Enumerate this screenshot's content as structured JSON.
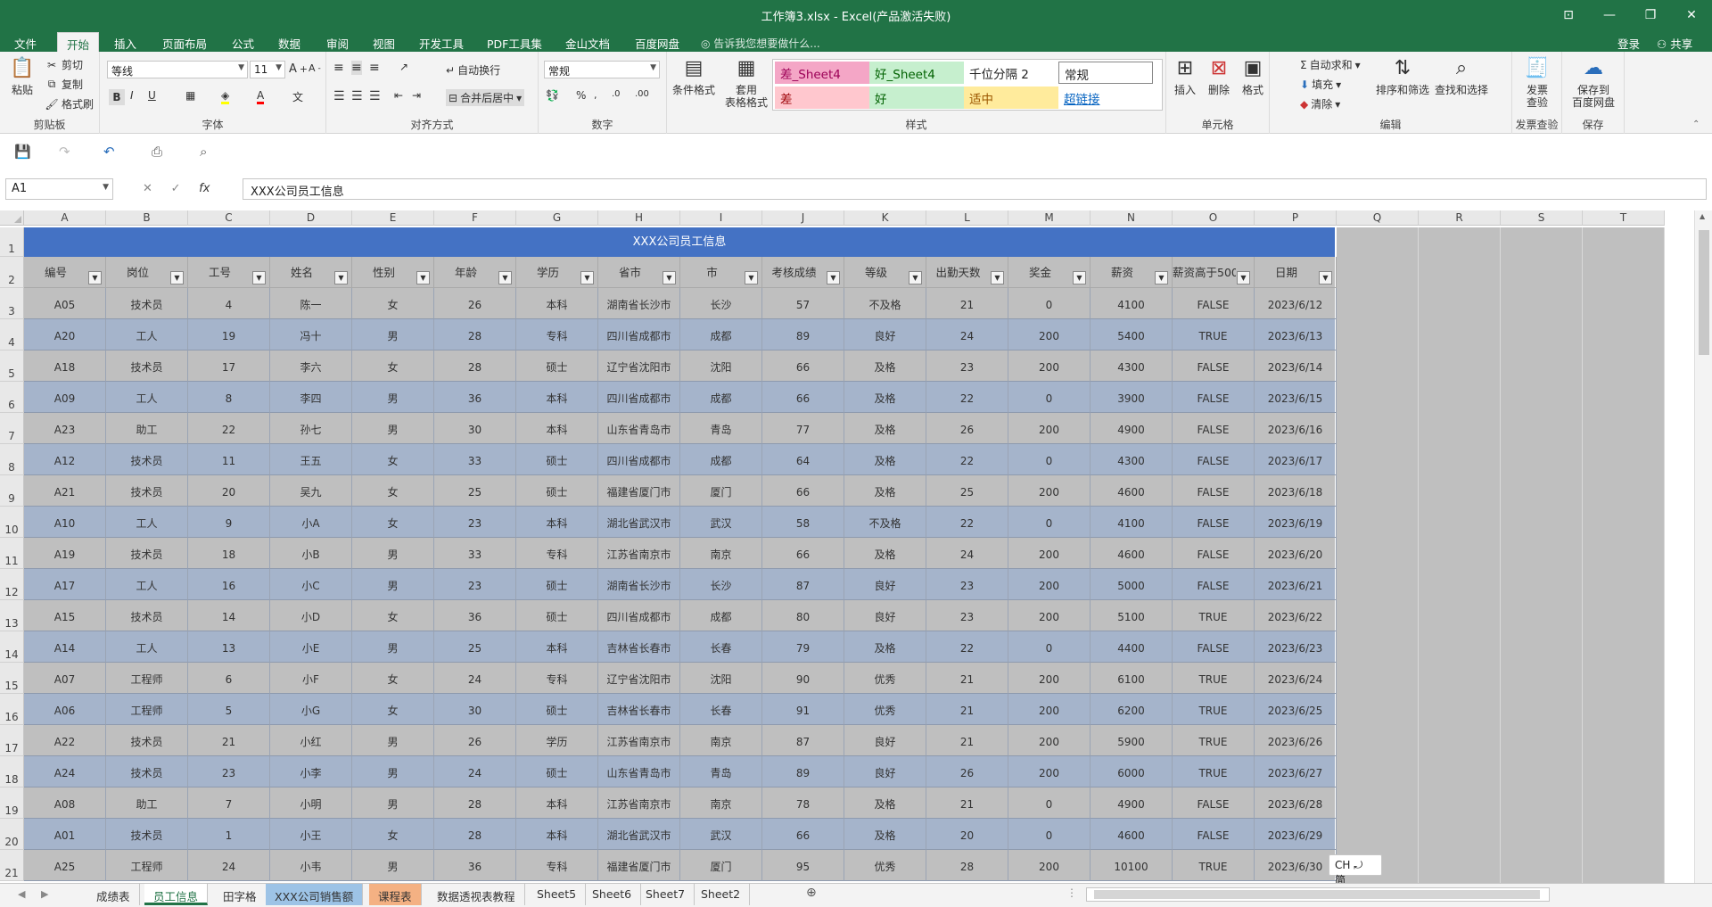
{
  "window": {
    "title": "工作簿3.xlsx - Excel(产品激活失败)",
    "controls": [
      "⊡",
      "—",
      "❐",
      "✕"
    ]
  },
  "tabs": [
    "文件",
    "开始",
    "插入",
    "页面布局",
    "公式",
    "数据",
    "审阅",
    "视图",
    "开发工具",
    "PDF工具集",
    "金山文档",
    "百度网盘"
  ],
  "active_tab": "开始",
  "tell_me": "告诉我您想要做什么...",
  "login": "登录",
  "share": "共享",
  "ribbon": {
    "clipboard": {
      "label": "剪贴板",
      "paste": "粘贴",
      "cut": "剪切",
      "copy": "复制",
      "format_painter": "格式刷"
    },
    "font": {
      "label": "字体",
      "font_name": "等线",
      "font_size": "11",
      "bold": "B",
      "italic": "I",
      "underline": "U"
    },
    "alignment": {
      "label": "对齐方式",
      "wrap": "自动换行",
      "merge": "合并后居中"
    },
    "number": {
      "label": "数字",
      "format": "常规"
    },
    "styles": {
      "label": "样式",
      "conditional": "条件格式",
      "table_format_1": "套用",
      "table_format_2": "表格格式",
      "cells": [
        {
          "text": "差_Sheet4",
          "bg": "#f4a6c6",
          "fg": "#9c0057"
        },
        {
          "text": "好_Sheet4",
          "bg": "#c6efce",
          "fg": "#006100"
        },
        {
          "text": "千位分隔 2",
          "bg": "#ffffff",
          "fg": "#222222"
        },
        {
          "text": "常规",
          "bg": "#ffffff",
          "fg": "#222222"
        },
        {
          "text": "差",
          "bg": "#ffc7ce",
          "fg": "#9c0006"
        },
        {
          "text": "好",
          "bg": "#c6efce",
          "fg": "#006100"
        },
        {
          "text": "适中",
          "bg": "#ffeb9c",
          "fg": "#9c5700"
        },
        {
          "text": "超链接",
          "bg": "#ffffff",
          "fg": "#0563c1"
        }
      ]
    },
    "cells_group": {
      "label": "单元格",
      "insert": "插入",
      "delete": "删除",
      "format": "格式"
    },
    "editing": {
      "label": "编辑",
      "autosum": "自动求和",
      "fill": "填充",
      "clear": "清除",
      "sort": "排序和筛选",
      "find": "查找和选择"
    },
    "invoice": {
      "label": "发票查验",
      "btn1": "发票",
      "btn2": "查验"
    },
    "save": {
      "label": "保存",
      "btn1": "保存到",
      "btn2": "百度网盘"
    }
  },
  "namebox": "A1",
  "formula": "XXX公司员工信息",
  "columns": [
    "A",
    "B",
    "C",
    "D",
    "E",
    "F",
    "G",
    "H",
    "I",
    "J",
    "K",
    "L",
    "M",
    "N",
    "O",
    "P",
    "Q",
    "R",
    "S",
    "T"
  ],
  "rows": [
    "1",
    "2",
    "3",
    "4",
    "5",
    "6",
    "7",
    "8",
    "9",
    "10",
    "11",
    "12",
    "13",
    "14",
    "15",
    "16",
    "17",
    "18",
    "19",
    "20",
    "21"
  ],
  "sheet_title": "XXX公司员工信息",
  "headers": [
    "编号",
    "岗位",
    "工号",
    "姓名",
    "性别",
    "年龄",
    "学历",
    "省市",
    "市",
    "考核成绩",
    "等级",
    "出勤天数",
    "奖金",
    "薪资",
    "薪资高于5000",
    "日期"
  ],
  "data": [
    [
      "A05",
      "技术员",
      "4",
      "陈一",
      "女",
      "26",
      "本科",
      "湖南省长沙市",
      "长沙",
      "57",
      "不及格",
      "21",
      "0",
      "4100",
      "FALSE",
      "2023/6/12"
    ],
    [
      "A20",
      "工人",
      "19",
      "冯十",
      "男",
      "28",
      "专科",
      "四川省成都市",
      "成都",
      "89",
      "良好",
      "24",
      "200",
      "5400",
      "TRUE",
      "2023/6/13"
    ],
    [
      "A18",
      "技术员",
      "17",
      "李六",
      "女",
      "28",
      "硕士",
      "辽宁省沈阳市",
      "沈阳",
      "66",
      "及格",
      "23",
      "200",
      "4300",
      "FALSE",
      "2023/6/14"
    ],
    [
      "A09",
      "工人",
      "8",
      "李四",
      "男",
      "36",
      "本科",
      "四川省成都市",
      "成都",
      "66",
      "及格",
      "22",
      "0",
      "3900",
      "FALSE",
      "2023/6/15"
    ],
    [
      "A23",
      "助工",
      "22",
      "孙七",
      "男",
      "30",
      "本科",
      "山东省青岛市",
      "青岛",
      "77",
      "及格",
      "26",
      "200",
      "4900",
      "FALSE",
      "2023/6/16"
    ],
    [
      "A12",
      "技术员",
      "11",
      "王五",
      "女",
      "33",
      "硕士",
      "四川省成都市",
      "成都",
      "64",
      "及格",
      "22",
      "0",
      "4300",
      "FALSE",
      "2023/6/17"
    ],
    [
      "A21",
      "技术员",
      "20",
      "吴九",
      "女",
      "25",
      "硕士",
      "福建省厦门市",
      "厦门",
      "66",
      "及格",
      "25",
      "200",
      "4600",
      "FALSE",
      "2023/6/18"
    ],
    [
      "A10",
      "工人",
      "9",
      "小A",
      "女",
      "23",
      "本科",
      "湖北省武汉市",
      "武汉",
      "58",
      "不及格",
      "22",
      "0",
      "4100",
      "FALSE",
      "2023/6/19"
    ],
    [
      "A19",
      "技术员",
      "18",
      "小B",
      "男",
      "33",
      "专科",
      "江苏省南京市",
      "南京",
      "66",
      "及格",
      "24",
      "200",
      "4600",
      "FALSE",
      "2023/6/20"
    ],
    [
      "A17",
      "工人",
      "16",
      "小C",
      "男",
      "23",
      "硕士",
      "湖南省长沙市",
      "长沙",
      "87",
      "良好",
      "23",
      "200",
      "5000",
      "FALSE",
      "2023/6/21"
    ],
    [
      "A15",
      "技术员",
      "14",
      "小D",
      "女",
      "36",
      "硕士",
      "四川省成都市",
      "成都",
      "80",
      "良好",
      "23",
      "200",
      "5100",
      "TRUE",
      "2023/6/22"
    ],
    [
      "A14",
      "工人",
      "13",
      "小E",
      "男",
      "25",
      "本科",
      "吉林省长春市",
      "长春",
      "79",
      "及格",
      "22",
      "0",
      "4400",
      "FALSE",
      "2023/6/23"
    ],
    [
      "A07",
      "工程师",
      "6",
      "小F",
      "女",
      "24",
      "专科",
      "辽宁省沈阳市",
      "沈阳",
      "90",
      "优秀",
      "21",
      "200",
      "6100",
      "TRUE",
      "2023/6/24"
    ],
    [
      "A06",
      "工程师",
      "5",
      "小G",
      "女",
      "30",
      "硕士",
      "吉林省长春市",
      "长春",
      "91",
      "优秀",
      "21",
      "200",
      "6200",
      "TRUE",
      "2023/6/25"
    ],
    [
      "A22",
      "技术员",
      "21",
      "小红",
      "男",
      "26",
      "学历",
      "江苏省南京市",
      "南京",
      "87",
      "良好",
      "21",
      "200",
      "5900",
      "TRUE",
      "2023/6/26"
    ],
    [
      "A24",
      "技术员",
      "23",
      "小李",
      "男",
      "24",
      "硕士",
      "山东省青岛市",
      "青岛",
      "89",
      "良好",
      "26",
      "200",
      "6000",
      "TRUE",
      "2023/6/27"
    ],
    [
      "A08",
      "助工",
      "7",
      "小明",
      "男",
      "28",
      "本科",
      "江苏省南京市",
      "南京",
      "78",
      "及格",
      "21",
      "0",
      "4900",
      "FALSE",
      "2023/6/28"
    ],
    [
      "A01",
      "技术员",
      "1",
      "小王",
      "女",
      "28",
      "本科",
      "湖北省武汉市",
      "武汉",
      "66",
      "及格",
      "20",
      "0",
      "4600",
      "FALSE",
      "2023/6/29"
    ],
    [
      "A25",
      "工程师",
      "24",
      "小韦",
      "男",
      "36",
      "专科",
      "福建省厦门市",
      "厦门",
      "95",
      "优秀",
      "28",
      "200",
      "10100",
      "TRUE",
      "2023/6/30"
    ]
  ],
  "ime": "CH ⤾ 简",
  "sheets": [
    {
      "name": "成绩表",
      "color": ""
    },
    {
      "name": "员工信息",
      "color": ""
    },
    {
      "name": "田字格",
      "color": ""
    },
    {
      "name": "XXX公司销售额",
      "color": "#9dc3e6"
    },
    {
      "name": "课程表",
      "color": "#f4b183"
    },
    {
      "name": "数据透视表教程",
      "color": ""
    },
    {
      "name": "Sheet5",
      "color": ""
    },
    {
      "name": "Sheet6",
      "color": ""
    },
    {
      "name": "Sheet7",
      "color": ""
    },
    {
      "name": "Sheet2",
      "color": ""
    }
  ],
  "active_sheet": "员工信息",
  "colors": {
    "accent": "#217346",
    "title_fill": "#4472c4",
    "row_gray": "#bfbfbf",
    "row_blue": "#a5b4cb",
    "annotation_arrow": "#e02020"
  }
}
